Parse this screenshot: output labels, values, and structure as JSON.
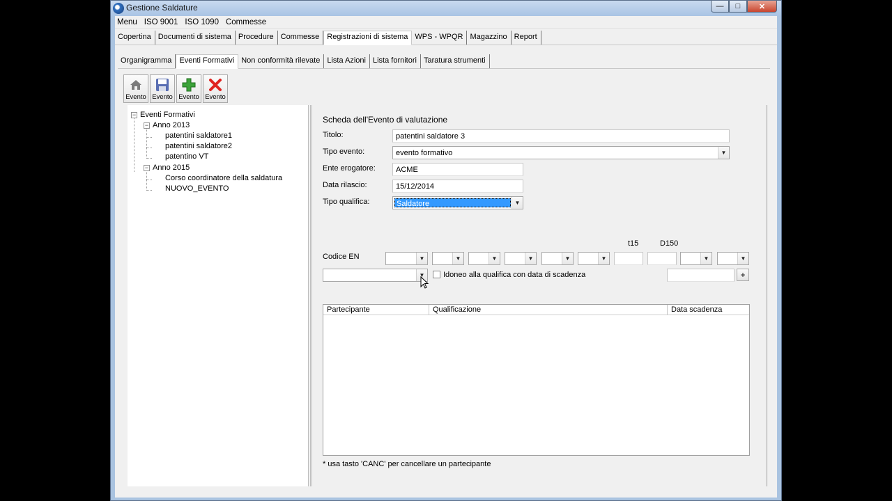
{
  "window": {
    "title": "Gestione Saldature",
    "minimize": "—",
    "maximize": "□",
    "close": "✕"
  },
  "menu": [
    "Menu",
    "ISO 9001",
    "ISO 1090",
    "Commesse"
  ],
  "tabs_main": [
    {
      "label": "Copertina"
    },
    {
      "label": "Documenti di sistema"
    },
    {
      "label": "Procedure"
    },
    {
      "label": "Commesse"
    },
    {
      "label": "Registrazioni di sistema",
      "active": true
    },
    {
      "label": "WPS - WPQR"
    },
    {
      "label": "Magazzino"
    },
    {
      "label": "Report"
    }
  ],
  "tabs_sub": [
    {
      "label": "Organigramma"
    },
    {
      "label": "Eventi Formativi",
      "active": true
    },
    {
      "label": "Non conformità rilevate"
    },
    {
      "label": "Lista Azioni"
    },
    {
      "label": "Lista fornitori"
    },
    {
      "label": "Taratura strumenti"
    }
  ],
  "toolbar": [
    {
      "label": "Evento",
      "icon": "home-icon"
    },
    {
      "label": "Evento",
      "icon": "save-icon"
    },
    {
      "label": "Evento",
      "icon": "add-icon"
    },
    {
      "label": "Evento",
      "icon": "delete-icon"
    }
  ],
  "tree": {
    "root": "Eventi Formativi",
    "years": [
      {
        "label": "Anno 2013",
        "items": [
          "patentini saldatore1",
          "patentini saldatore2",
          "patentino VT"
        ]
      },
      {
        "label": "Anno 2015",
        "items": [
          "Corso coordinatore della saldatura",
          "NUOVO_EVENTO"
        ]
      }
    ]
  },
  "form": {
    "title": "Scheda dell'Evento di valutazione",
    "titolo_label": "Titolo:",
    "titolo_value": "patentini saldatore 3",
    "tipo_evento_label": "Tipo evento:",
    "tipo_evento_value": "evento formativo",
    "ente_label": "Ente erogatore:",
    "ente_value": "ACME",
    "data_label": "Data rilascio:",
    "data_value": "15/12/2014",
    "tipo_qualifica_label": "Tipo qualifica:",
    "tipo_qualifica_value": "Saldatore",
    "codice_en_label": "Codice EN",
    "t15_label": "t15",
    "d150_label": "D150",
    "idoneo_label": "Idoneo alla qualifica con data di scadenza",
    "plus_label": "+",
    "grid_headers": [
      "Partecipante",
      "Qualificazione",
      "Data scadenza"
    ],
    "note": "* usa tasto 'CANC' per cancellare un partecipante"
  },
  "colors": {
    "selection": "#3399ff",
    "window_frame": "#a9c3e0"
  }
}
